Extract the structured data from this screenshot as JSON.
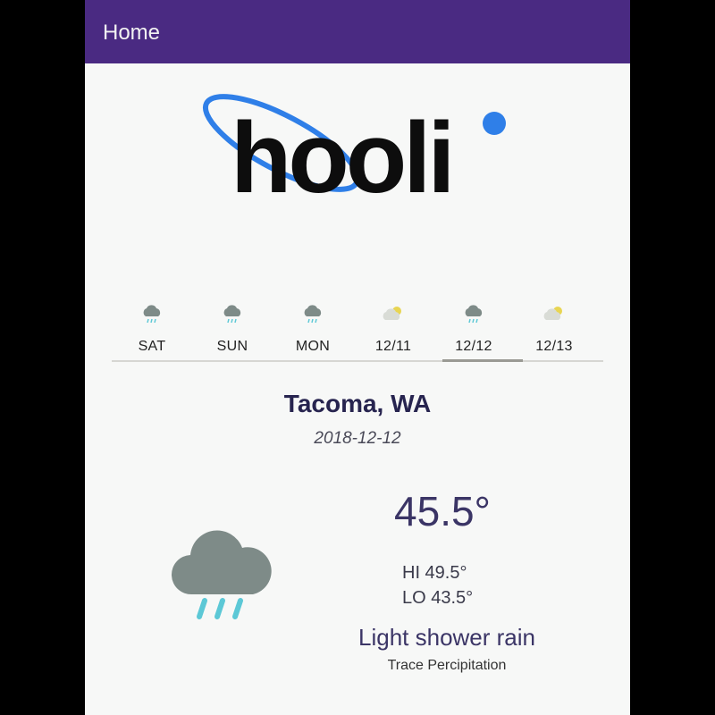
{
  "appbar": {
    "title": "Home",
    "color": "#4a2a82"
  },
  "logo": {
    "text": "hooli",
    "accent_color": "#2f7fe8"
  },
  "forecast_tabs": [
    {
      "label": "SAT",
      "icon": "rain-cloud-icon"
    },
    {
      "label": "SUN",
      "icon": "rain-cloud-icon"
    },
    {
      "label": "MON",
      "icon": "rain-cloud-icon"
    },
    {
      "label": "12/11",
      "icon": "partly-cloudy-icon"
    },
    {
      "label": "12/12",
      "icon": "rain-cloud-icon",
      "selected": true
    },
    {
      "label": "12/13",
      "icon": "partly-cloudy-icon"
    }
  ],
  "weather": {
    "city": "Tacoma, WA",
    "date": "2018-12-12",
    "temperature": "45.5°",
    "hi": "HI 49.5°",
    "lo": "LO 43.5°",
    "description": "Light shower rain",
    "precipitation": "Trace Percipitation",
    "icon": "rain-cloud-icon",
    "cloud_color": "#7e8b88",
    "rain_color": "#5cc8d6"
  }
}
